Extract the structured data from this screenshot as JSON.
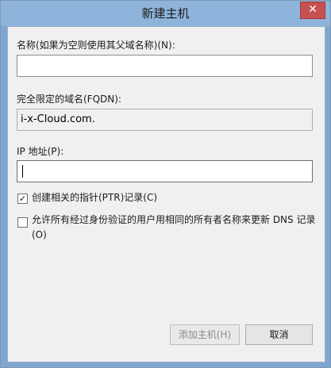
{
  "window": {
    "title": "新建主机",
    "close_glyph": "✕"
  },
  "name_field": {
    "label": "名称(如果为空则使用其父域名称)(N):",
    "value": ""
  },
  "fqdn_field": {
    "label": "完全限定的域名(FQDN):",
    "value": "i-x-Cloud.com."
  },
  "ip_field": {
    "label": "IP 地址(P):",
    "value": ""
  },
  "checkbox_ptr": {
    "label": "创建相关的指针(PTR)记录(C)",
    "checked": true,
    "check_glyph": "✓"
  },
  "checkbox_update": {
    "label": "允许所有经过身份验证的用户用相同的所有者名称来更新 DNS 记录(O)",
    "checked": false
  },
  "buttons": {
    "add_host": "添加主机(H)",
    "cancel": "取消"
  },
  "colors": {
    "titlebar": "#8eb4dc",
    "close_button": "#c75050",
    "dialog_bg": "#f0f0f0"
  }
}
